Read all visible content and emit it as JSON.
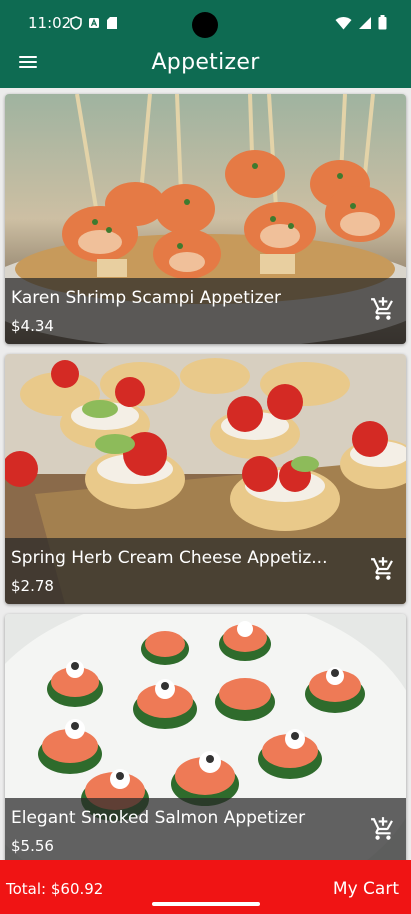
{
  "status_bar": {
    "time": "11:02",
    "left_icons": [
      "shield-icon",
      "font-icon",
      "sd-card-icon"
    ],
    "right_icons": [
      "wifi-icon",
      "signal-icon",
      "battery-icon"
    ]
  },
  "app_bar": {
    "title": "Appetizer",
    "menu_icon": "hamburger-menu-icon",
    "color": "#0e6b52"
  },
  "items": [
    {
      "name": "Karen Shrimp Scampi Appetizer",
      "price": "$4.34",
      "image": "shrimp-skewers-photo"
    },
    {
      "name": "Spring Herb Cream Cheese Appetiz...",
      "price": "$2.78",
      "image": "cream-cheese-cups-photo"
    },
    {
      "name": "Elegant Smoked Salmon Appetizer",
      "price": "$5.56",
      "image": "smoked-salmon-cucumber-photo"
    }
  ],
  "cart_icon": "add-shopping-cart-icon",
  "bottom_bar": {
    "total": "Total: $60.92",
    "cart_label": "My Cart",
    "color": "#f01414"
  }
}
